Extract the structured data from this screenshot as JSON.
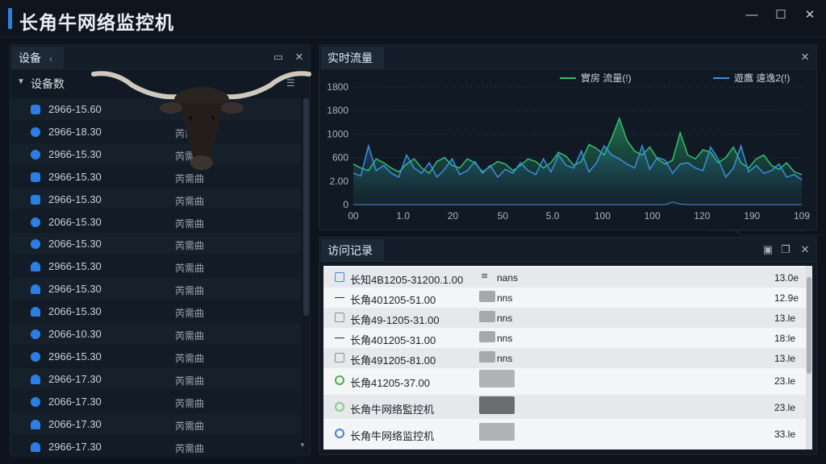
{
  "app": {
    "title": "长角牛网络监控机",
    "window_controls": {
      "minimize": "—",
      "maximize": "☐",
      "close": "✕"
    }
  },
  "devices_panel": {
    "tab_label": "设备",
    "tab_close": "‹",
    "tree_root": "设备数",
    "rows": [
      {
        "time": "2966-15.60",
        "status": "",
        "icon": "folder-icon"
      },
      {
        "time": "2966-18.30",
        "status": "芮需曲",
        "icon": "globe-icon"
      },
      {
        "time": "2966-15.30",
        "status": "芮需曲",
        "icon": "globe-icon"
      },
      {
        "time": "2966-15.30",
        "status": "芮需曲",
        "icon": "device-icon"
      },
      {
        "time": "2966-15.30",
        "status": "芮需曲",
        "icon": "device-icon"
      },
      {
        "time": "2066-15.30",
        "status": "芮需曲",
        "icon": "globe-icon"
      },
      {
        "time": "2066-15.30",
        "status": "芮需曲",
        "icon": "globe-icon"
      },
      {
        "time": "2966-15.30",
        "status": "芮需曲",
        "icon": "person-icon"
      },
      {
        "time": "2966-15.30",
        "status": "芮需曲",
        "icon": "person-icon"
      },
      {
        "time": "2066-15.30",
        "status": "芮需曲",
        "icon": "person-icon"
      },
      {
        "time": "2066-10.30",
        "status": "芮需曲",
        "icon": "globe-icon"
      },
      {
        "time": "2966-15.30",
        "status": "芮需曲",
        "icon": "globe-icon"
      },
      {
        "time": "2966-17.30",
        "status": "芮需曲",
        "icon": "person-icon"
      },
      {
        "time": "2066-17.30",
        "status": "芮需曲",
        "icon": "globe-icon"
      },
      {
        "time": "2066-17.30",
        "status": "芮需曲",
        "icon": "person-icon"
      },
      {
        "time": "2966-17.30",
        "status": "芮需曲",
        "icon": "person-icon"
      }
    ]
  },
  "traffic_panel": {
    "tab_label": "实时流量",
    "close": "✕",
    "chart_data": {
      "type": "area",
      "legend_position": "top-right",
      "series": [
        {
          "name": "實房 流量(!)",
          "color": "#2fbf71"
        },
        {
          "name": "遊鷹 遠逸2(!)",
          "color": "#3b8fe0"
        }
      ],
      "x_tick_labels": [
        "00",
        "1.0",
        "20",
        "50",
        "5.0",
        "100",
        "100",
        "120",
        "190",
        "109"
      ],
      "y_tick_labels": [
        "1800",
        "1800",
        "1000",
        "600",
        "2.00",
        "0"
      ],
      "ylim": [
        0,
        1800
      ],
      "grid": true,
      "values_a": [
        620,
        560,
        520,
        700,
        640,
        560,
        500,
        620,
        700,
        560,
        480,
        660,
        720,
        600,
        560,
        700,
        640,
        500,
        580,
        660,
        620,
        520,
        600,
        700,
        660,
        560,
        640,
        800,
        740,
        600,
        660,
        920,
        860,
        760,
        1020,
        1320,
        980,
        820,
        760,
        880,
        700,
        620,
        680,
        1100,
        760,
        700,
        840,
        800,
        640,
        720,
        880,
        640,
        560,
        700,
        760,
        600,
        540,
        640,
        500,
        460
      ],
      "values_b": [
        480,
        440,
        900,
        520,
        600,
        480,
        420,
        760,
        560,
        480,
        640,
        420,
        540,
        700,
        460,
        520,
        660,
        480,
        600,
        420,
        540,
        480,
        640,
        520,
        460,
        700,
        500,
        760,
        600,
        560,
        820,
        500,
        640,
        900,
        760,
        700,
        620,
        560,
        900,
        540,
        720,
        680,
        480,
        620,
        640,
        560,
        520,
        880,
        700,
        420,
        560,
        900,
        500,
        600,
        480,
        520,
        620,
        420,
        460,
        380
      ],
      "values_c": [
        0,
        0,
        0,
        0,
        0,
        0,
        0,
        0,
        0,
        0,
        0,
        0,
        0,
        0,
        0,
        0,
        0,
        0,
        0,
        0,
        0,
        0,
        0,
        0,
        0,
        0,
        0,
        0,
        0,
        0,
        0,
        0,
        0,
        0,
        0,
        0,
        0,
        0,
        0,
        0,
        0,
        0,
        40,
        10,
        0,
        0,
        0,
        0,
        0,
        0,
        0,
        0,
        0,
        0,
        0,
        0,
        0,
        0,
        0,
        0
      ]
    }
  },
  "records_panel": {
    "tab_label": "访问记录",
    "close": "✕",
    "rows": [
      {
        "mark": "box-blue",
        "name": "长知4B1205-31200.1.00",
        "has_wifi": true,
        "type": "nans",
        "thumb": "none",
        "size": "13.0e"
      },
      {
        "mark": "dash",
        "name": "长角401205-51.00",
        "has_wifi": false,
        "type": "nns",
        "thumb": "small",
        "size": "12.9e"
      },
      {
        "mark": "box",
        "name": "长角49-1205-31.00",
        "has_wifi": false,
        "type": "nns",
        "thumb": "small",
        "size": "13.le"
      },
      {
        "mark": "dash",
        "name": "长角401205-31.00",
        "has_wifi": false,
        "type": "nns",
        "thumb": "small",
        "size": "18:le"
      },
      {
        "mark": "box",
        "name": "长角491205-81.00",
        "has_wifi": false,
        "type": "nns",
        "thumb": "small",
        "size": "13.le"
      },
      {
        "mark": "ring",
        "name": "长角41205-37.00",
        "has_wifi": false,
        "type": "",
        "thumb": "big",
        "size": "23.le"
      },
      {
        "mark": "ring-light",
        "name": "长角牛网络監控机",
        "has_wifi": false,
        "type": "",
        "thumb": "big-dark",
        "size": "23.le"
      },
      {
        "mark": "ring-blue",
        "name": "长角牛网络监控机",
        "has_wifi": false,
        "type": "",
        "thumb": "big",
        "size": "33.le"
      }
    ]
  }
}
